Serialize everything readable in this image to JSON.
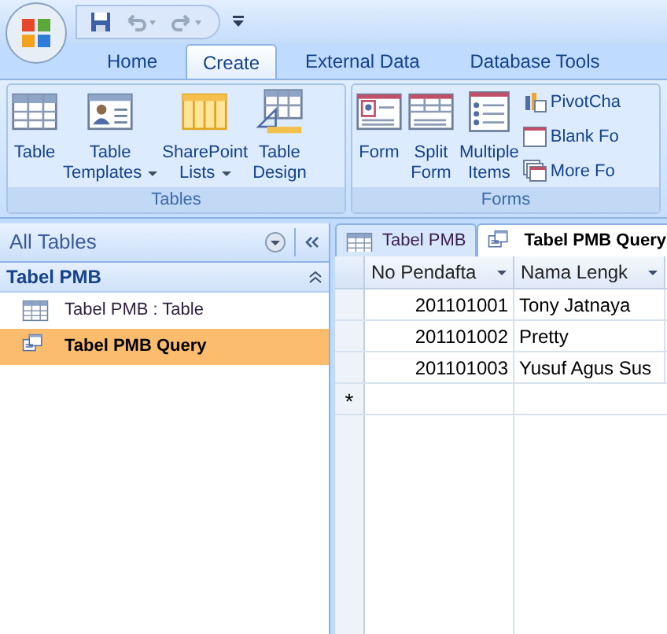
{
  "ribbon_tabs": [
    {
      "label": "Home",
      "selected": false
    },
    {
      "label": "Create",
      "selected": true
    },
    {
      "label": "External Data",
      "selected": false
    },
    {
      "label": "Database Tools",
      "selected": false
    }
  ],
  "ribbon_groups": [
    {
      "title": "Tables",
      "buttons": [
        {
          "kind": "table",
          "label": "Table",
          "has_menu": false
        },
        {
          "kind": "template",
          "label": "Table Templates",
          "has_menu": true
        },
        {
          "kind": "sharepoint",
          "label": "SharePoint Lists",
          "has_menu": true
        },
        {
          "kind": "design",
          "label": "Table Design",
          "has_menu": false
        }
      ]
    },
    {
      "title": "Forms",
      "buttons": [
        {
          "kind": "form",
          "label": "Form",
          "has_menu": false
        },
        {
          "kind": "split",
          "label": "Split Form",
          "has_menu": false
        },
        {
          "kind": "multiple",
          "label": "Multiple Items",
          "has_menu": false
        }
      ],
      "small_buttons": [
        {
          "kind": "pivot",
          "label": "PivotCha"
        },
        {
          "kind": "blank",
          "label": "Blank Fo"
        },
        {
          "kind": "more",
          "label": "More Fo"
        }
      ]
    }
  ],
  "nav_pane": {
    "title": "All Tables",
    "groups": [
      {
        "label": "Tabel PMB",
        "expanded": true,
        "children": [
          {
            "kind": "table",
            "label": "Tabel PMB : Table",
            "selected": false
          },
          {
            "kind": "query",
            "label": "Tabel PMB Query",
            "selected": true
          }
        ]
      }
    ]
  },
  "document_tabs": [
    {
      "kind": "table",
      "label": "Tabel PMB",
      "selected": false
    },
    {
      "kind": "query",
      "label": "Tabel PMB Query",
      "selected": true
    }
  ],
  "datasheet": {
    "columns": [
      "No Pendafta",
      "Nama Lengk"
    ],
    "rows": [
      [
        "201101001",
        "Tony Jatnaya"
      ],
      [
        "201101002",
        "Pretty"
      ],
      [
        "201101003",
        "Yusuf Agus Sus"
      ]
    ],
    "new_row_marker": "*"
  }
}
